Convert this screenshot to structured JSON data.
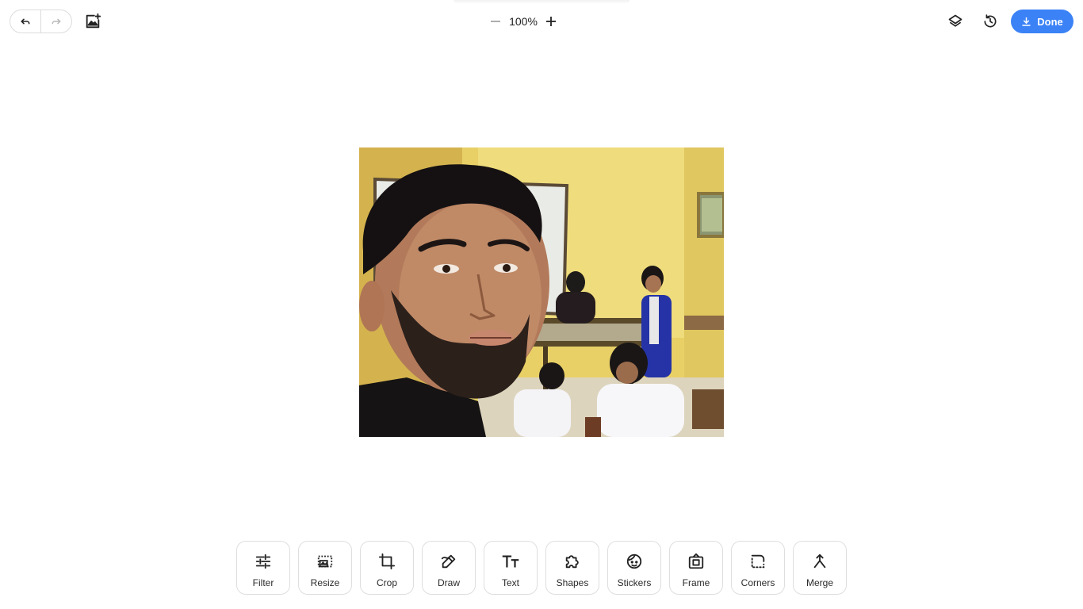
{
  "topbar": {
    "undo_label": "Undo",
    "redo_label": "Redo",
    "add_image_label": "Add image",
    "zoom": {
      "value": "100%"
    },
    "layers_label": "Layers",
    "history_label": "History",
    "done_label": "Done"
  },
  "canvas": {
    "image_description": "selfie photo in classroom"
  },
  "toolbar": {
    "tools": [
      {
        "label": "Filter",
        "icon": "sliders-icon"
      },
      {
        "label": "Resize",
        "icon": "resize-icon"
      },
      {
        "label": "Crop",
        "icon": "crop-icon"
      },
      {
        "label": "Draw",
        "icon": "pen-icon"
      },
      {
        "label": "Text",
        "icon": "text-icon"
      },
      {
        "label": "Shapes",
        "icon": "puzzle-icon"
      },
      {
        "label": "Stickers",
        "icon": "sticker-face-icon"
      },
      {
        "label": "Frame",
        "icon": "frame-icon"
      },
      {
        "label": "Corners",
        "icon": "corners-icon"
      },
      {
        "label": "Merge",
        "icon": "merge-icon"
      }
    ]
  },
  "colors": {
    "accent": "#3b82f6",
    "border": "#dedede"
  }
}
